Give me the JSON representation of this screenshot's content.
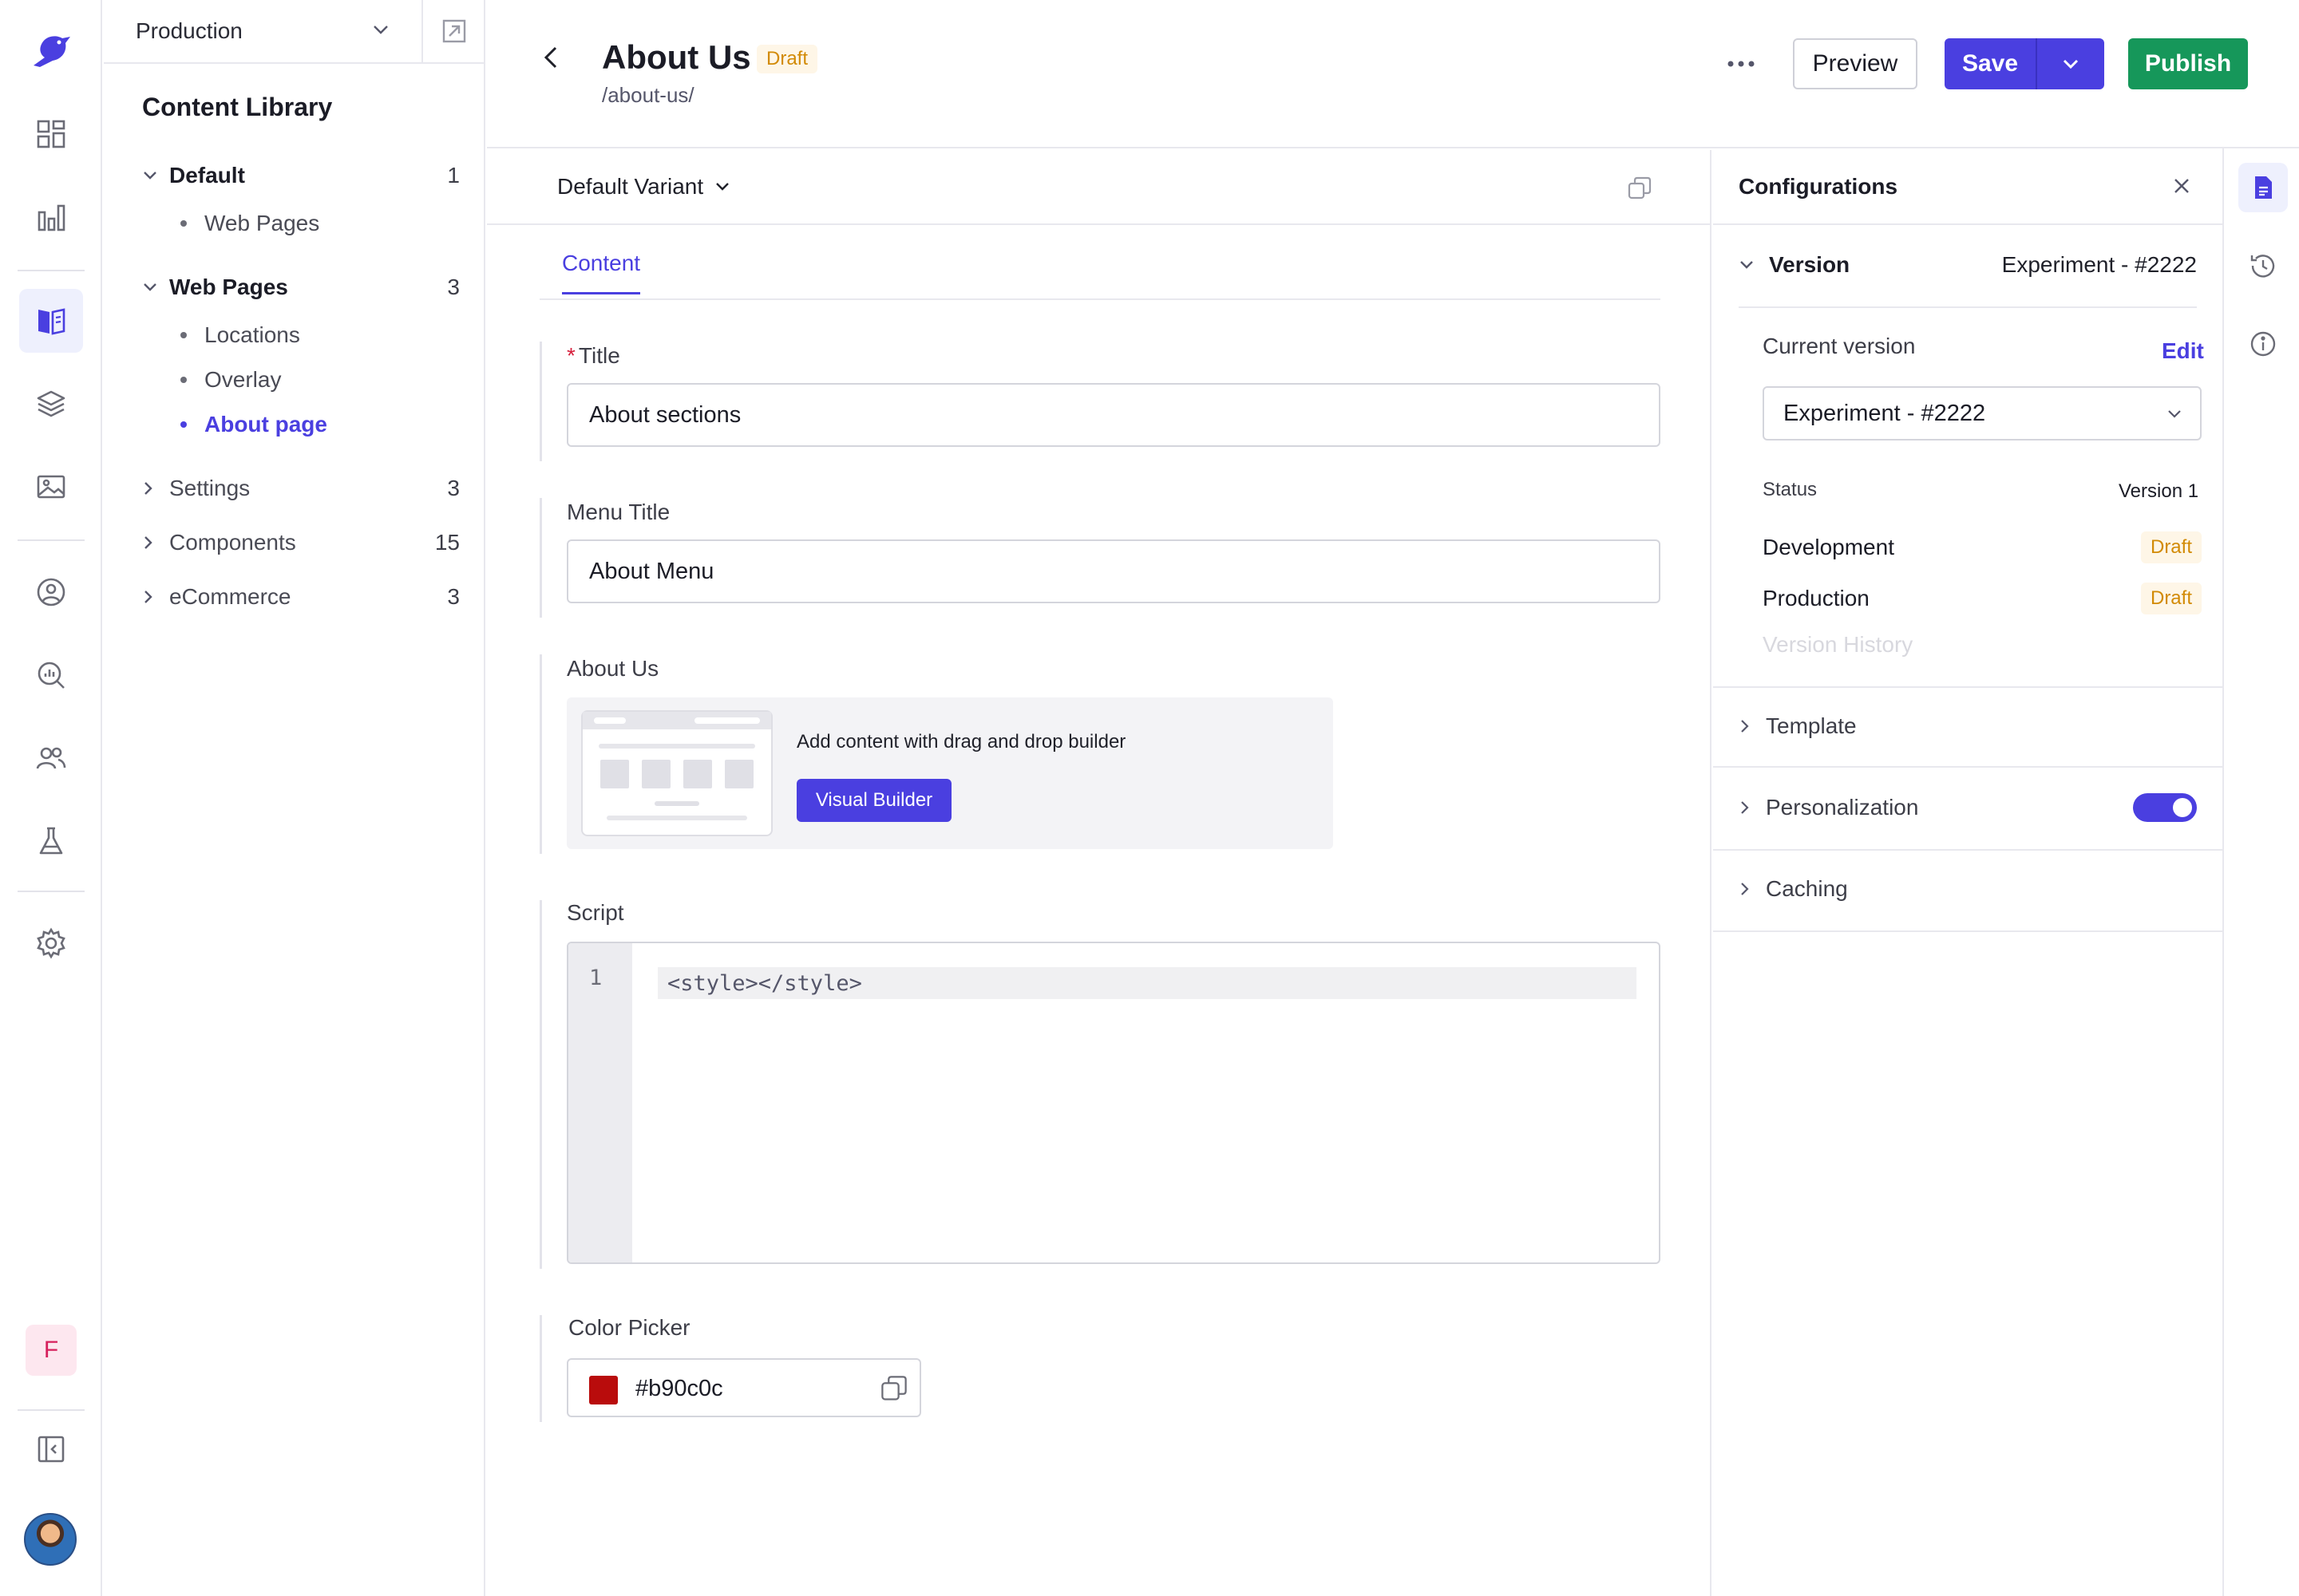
{
  "colors": {
    "accent": "#4a3fe0",
    "publish": "#16975a",
    "draft_text": "#d28a05",
    "draft_bg": "#fef6e7"
  },
  "rail": {
    "icons": [
      "logo-bird-icon",
      "dashboard-grid-icon",
      "analytics-chart-icon",
      "content-library-book-icon",
      "layers-icon",
      "media-image-icon",
      "audience-user-circle-icon",
      "insights-search-icon",
      "team-users-icon",
      "experiments-flask-icon",
      "settings-gear-icon",
      "collapse-sidebar-icon"
    ],
    "active": "content-library-book-icon",
    "workspace_initial": "F"
  },
  "library": {
    "environment": "Production",
    "title": "Content Library",
    "tree": [
      {
        "label": "Default",
        "count": "1",
        "expanded": true,
        "children": [
          "Web Pages"
        ]
      },
      {
        "label": "Web Pages",
        "count": "3",
        "expanded": true,
        "children": [
          "Locations",
          "Overlay",
          "About page"
        ],
        "active_child": "About page"
      },
      {
        "label": "Settings",
        "count": "3",
        "expanded": false
      },
      {
        "label": "Components",
        "count": "15",
        "expanded": false
      },
      {
        "label": "eCommerce",
        "count": "3",
        "expanded": false
      }
    ]
  },
  "header": {
    "title": "About Us",
    "status_badge": "Draft",
    "path": "/about-us/",
    "preview_label": "Preview",
    "save_label": "Save",
    "publish_label": "Publish"
  },
  "editor": {
    "variant": "Default Variant",
    "tabs": [
      {
        "label": "Content",
        "active": true
      }
    ],
    "fields": {
      "title": {
        "label": "Title",
        "required": true,
        "value": "About sections"
      },
      "menu_title": {
        "label": "Menu Title",
        "value": "About Menu"
      },
      "about_us": {
        "label": "About Us",
        "prompt": "Add content with drag and drop builder",
        "button": "Visual Builder"
      },
      "script": {
        "label": "Script",
        "line_number": "1",
        "code": "<style></style>"
      },
      "color_picker": {
        "label": "Color Picker",
        "value": "#b90c0c"
      }
    }
  },
  "config": {
    "title": "Configurations",
    "version": {
      "label": "Version",
      "value": "Experiment - #2222",
      "current_label": "Current version",
      "edit_label": "Edit",
      "selected": "Experiment - #2222",
      "status_label": "Status",
      "status_version": "Version 1",
      "environments": [
        {
          "name": "Development",
          "status": "Draft"
        },
        {
          "name": "Production",
          "status": "Draft"
        }
      ],
      "history_label": "Version History"
    },
    "sections": [
      {
        "label": "Template"
      },
      {
        "label": "Personalization",
        "toggle": true
      },
      {
        "label": "Caching"
      }
    ]
  },
  "util_rail": {
    "icons": [
      "document-icon",
      "history-icon",
      "info-icon"
    ],
    "active": "document-icon"
  }
}
